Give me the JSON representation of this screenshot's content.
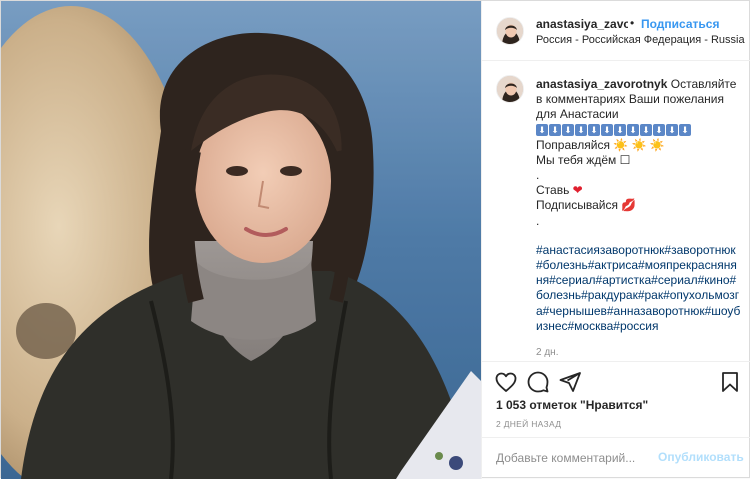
{
  "post": {
    "username": "anastasiya_zavoi",
    "separator": "•",
    "follow_label": "Подписаться",
    "location": "Россия - Российская Федерация - Russia"
  },
  "caption": {
    "username": "anastasiya_zavorotnyk",
    "line1": "Оставляйте в комментариях Ваши пожелания для Анастасии",
    "arrow_glyph": "⬇",
    "arrow_count": 12,
    "line_get_well": "Поправляйся",
    "suns": "☀️ ☀️ ☀️",
    "line_waiting": "Мы тебя ждём",
    "box_glyph": "☐",
    "dot1": ".",
    "line_like": "Ставь",
    "heart": "❤",
    "line_subscribe": "Подписывайся",
    "lips": "💋",
    "dot2": ".",
    "hashtags": "#анастасиязаворотнюк#заворотнюк#болезнь#актриса#мояпрекрасняняня#сериал#артистка#сериал#кино#болезнь#ракдурак#рак#опухольмозга#чернышев#анназаворотнюк#шоубизнес#москва#россия",
    "time": "2 дн."
  },
  "actions": {
    "like_icon": "heart-outline-icon",
    "comment_icon": "comment-bubble-icon",
    "share_icon": "paper-plane-icon",
    "save_icon": "bookmark-icon",
    "likes_text": "1 053 отметок \"Нравится\"",
    "posted_ago": "2 ДНЕЙ НАЗАД"
  },
  "comment": {
    "placeholder": "Добавьте комментарий...",
    "publish_label": "Опубликовать"
  },
  "colors": {
    "accent": "#3897f0",
    "publish_disabled": "#b2dffc",
    "hashtag": "#00376b",
    "muted": "#8e8e8e"
  }
}
